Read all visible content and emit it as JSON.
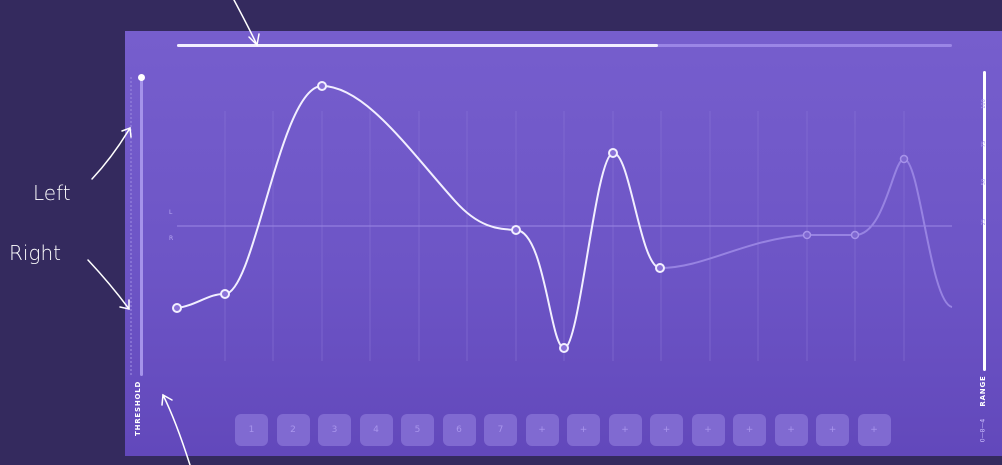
{
  "annotations": {
    "left_label": "Left",
    "right_label": "Right"
  },
  "panel": {
    "progress": 0.62,
    "threshold_label": "THRESHOLD",
    "range_label": "RANGE",
    "range_sub": "0—8—4",
    "range_ticks": [
      "100",
      "75",
      "50",
      "25"
    ],
    "channel_labels": [
      "L",
      "R"
    ],
    "steps": [
      "1",
      "2",
      "3",
      "4",
      "5",
      "6",
      "7",
      "+",
      "+",
      "+",
      "+",
      "+",
      "+",
      "+",
      "+",
      "+"
    ],
    "colors": {
      "background": "#342a5e",
      "panel": "#765ecd",
      "curve": "#f2efff",
      "curve_dim": "#9783e2"
    }
  }
}
